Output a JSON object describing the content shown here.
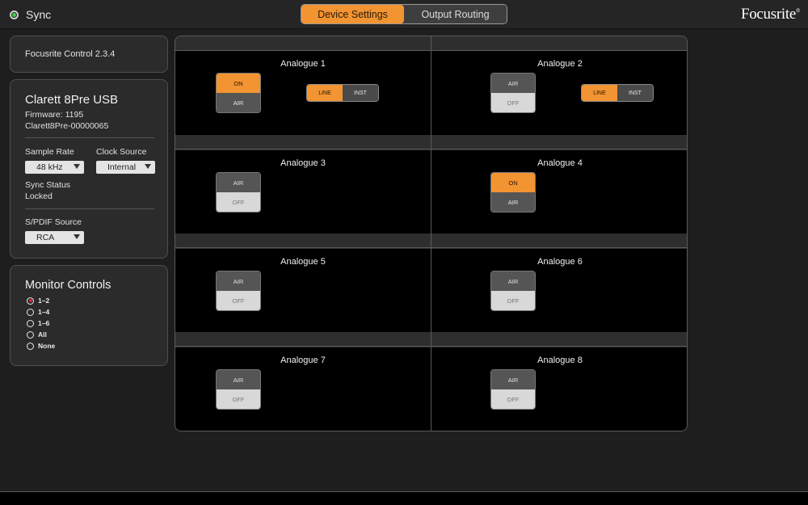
{
  "topbar": {
    "sync_label": "Sync",
    "tabs": [
      {
        "label": "Device Settings",
        "active": true
      },
      {
        "label": "Output Routing",
        "active": false
      }
    ],
    "logo": "Focusrite",
    "logo_mark": "®"
  },
  "info": {
    "app_version": "Focusrite Control 2.3.4",
    "device_name": "Clarett 8Pre USB",
    "firmware": "Firmware: 1195",
    "serial": "Clarett8Pre-00000065",
    "sample_rate_label": "Sample Rate",
    "sample_rate_value": "48 kHz",
    "clock_source_label": "Clock Source",
    "clock_source_value": "Internal",
    "sync_status_label": "Sync Status",
    "sync_status_value": "Locked",
    "spdif_label": "S/PDIF Source",
    "spdif_value": "RCA"
  },
  "monitor": {
    "title": "Monitor Controls",
    "options": [
      {
        "label": "1–2",
        "checked": true
      },
      {
        "label": "1–4",
        "checked": false
      },
      {
        "label": "1–6",
        "checked": false
      },
      {
        "label": "All",
        "checked": false
      },
      {
        "label": "None",
        "checked": false
      }
    ]
  },
  "channels": [
    {
      "name": "Analogue 1",
      "top": "ON",
      "bottom": "AIR",
      "air_on": true,
      "has_inst": true,
      "line": "LINE",
      "inst": "INST"
    },
    {
      "name": "Analogue 2",
      "top": "AIR",
      "bottom": "OFF",
      "air_on": false,
      "has_inst": true,
      "line": "LINE",
      "inst": "INST"
    },
    {
      "name": "Analogue 3",
      "top": "AIR",
      "bottom": "OFF",
      "air_on": false,
      "has_inst": false
    },
    {
      "name": "Analogue 4",
      "top": "ON",
      "bottom": "AIR",
      "air_on": true,
      "has_inst": false
    },
    {
      "name": "Analogue 5",
      "top": "AIR",
      "bottom": "OFF",
      "air_on": false,
      "has_inst": false
    },
    {
      "name": "Analogue 6",
      "top": "AIR",
      "bottom": "OFF",
      "air_on": false,
      "has_inst": false
    },
    {
      "name": "Analogue 7",
      "top": "AIR",
      "bottom": "OFF",
      "air_on": false,
      "has_inst": false
    },
    {
      "name": "Analogue 8",
      "top": "AIR",
      "bottom": "OFF",
      "air_on": false,
      "has_inst": false
    }
  ],
  "colors": {
    "accent": "#f29432",
    "sync_led": "#3fcf4f",
    "radio_selected": "#e0223a"
  }
}
